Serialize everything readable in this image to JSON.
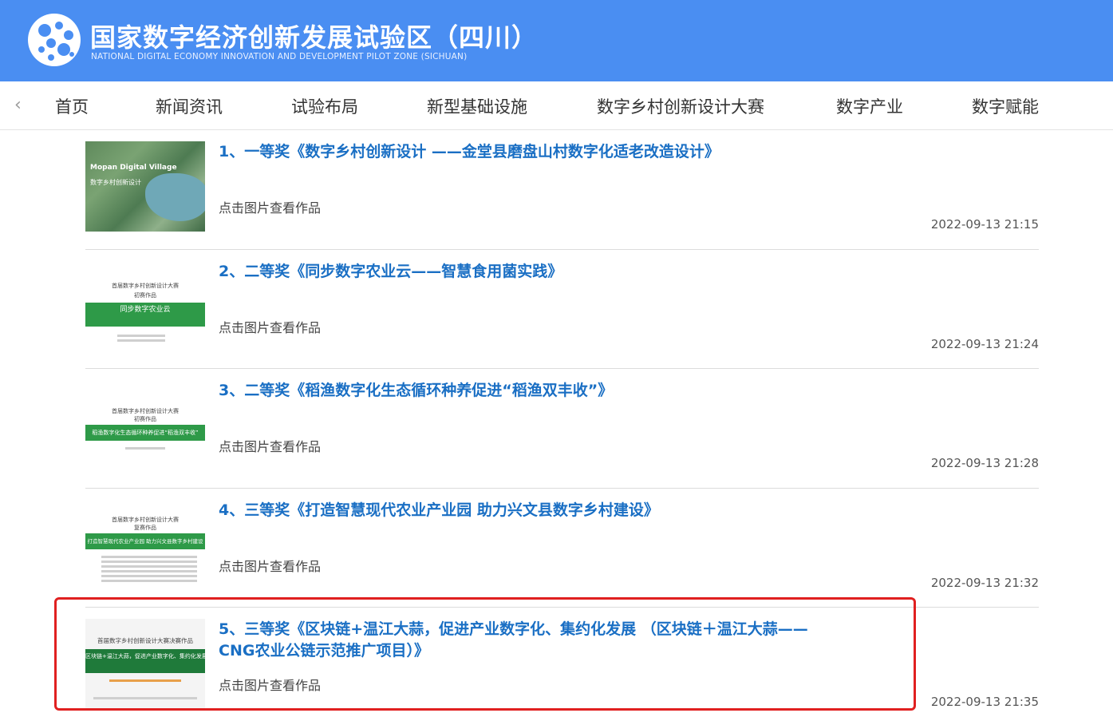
{
  "header": {
    "title": "国家数字经济创新发展试验区（四川）",
    "subtitle": "NATIONAL DIGITAL ECONOMY INNOVATION AND DEVELOPMENT PILOT ZONE (SICHUAN)"
  },
  "nav": {
    "items": [
      {
        "label": "首页"
      },
      {
        "label": "新闻资讯"
      },
      {
        "label": "试验布局"
      },
      {
        "label": "新型基础设施"
      },
      {
        "label": "数字乡村创新设计大赛"
      },
      {
        "label": "数字产业"
      },
      {
        "label": "数字赋能"
      }
    ]
  },
  "list": {
    "items": [
      {
        "title": "1、一等奖《数字乡村创新设计 ——金堂县磨盘山村数字化适老改造设计》",
        "hint": "点击图片查看作品",
        "date": "2022-09-13 21:15",
        "thumb": {
          "line1": "Mopan Digital Village",
          "line2": "数字乡村创新设计"
        }
      },
      {
        "title": "2、二等奖《同步数字农业云——智慧食用菌实践》",
        "hint": "点击图片查看作品",
        "date": "2022-09-13 21:24",
        "thumb": {
          "line1": "首届数字乡村创新设计大赛",
          "line2": "初赛作品",
          "band": "同步数字农业云"
        }
      },
      {
        "title": "3、二等奖《稻渔数字化生态循环种养促进“稻渔双丰收”》",
        "hint": "点击图片查看作品",
        "date": "2022-09-13 21:28",
        "thumb": {
          "line1": "首届数字乡村创新设计大赛",
          "line2": "初赛作品",
          "band": "稻渔数字化生态循环种养促进“稻渔双丰收”"
        }
      },
      {
        "title": "4、三等奖《打造智慧现代农业产业园 助力兴文县数字乡村建设》",
        "hint": "点击图片查看作品",
        "date": "2022-09-13 21:32",
        "thumb": {
          "line1": "首届数字乡村创新设计大赛",
          "line2": "复赛作品",
          "band": "打造智慧现代农业产业园 助力兴文县数字乡村建设"
        }
      },
      {
        "title": "5、三等奖《区块链+温江大蒜，促进产业数字化、集约化发展 （区块链＋温江大蒜——CNG农业公链示范推广项目）》",
        "hint": "点击图片查看作品",
        "date": "2022-09-13 21:35",
        "thumb": {
          "line1": "首届数字乡村创新设计大赛决赛作品",
          "band": "区块链+温江大蒜，促进产业数字化、集约化发展"
        }
      }
    ]
  }
}
